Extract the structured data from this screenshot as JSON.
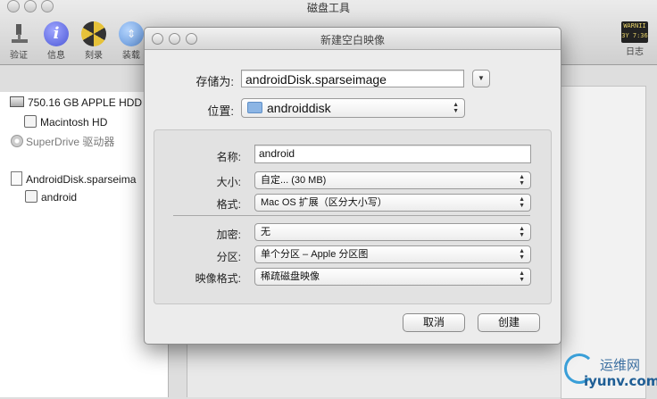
{
  "app": {
    "title": "磁盘工具",
    "toolbar": [
      {
        "label": "验证",
        "icon": "microscope-icon"
      },
      {
        "label": "信息",
        "icon": "info-icon"
      },
      {
        "label": "刻录",
        "icon": "burn-icon"
      },
      {
        "label": "装载",
        "icon": "mount-icon"
      },
      {
        "label": "日志",
        "icon": "log-icon",
        "icon_text": "WARNII\n3Y 7:36"
      }
    ],
    "sidebar": {
      "items": [
        {
          "label": "750.16 GB APPLE HDD",
          "type": "disk"
        },
        {
          "label": "Macintosh HD",
          "type": "volume"
        },
        {
          "label": "SuperDrive 驱动器",
          "type": "optical"
        },
        {
          "label": "AndroidDisk.sparseima",
          "type": "image"
        },
        {
          "label": "android",
          "type": "volume"
        }
      ]
    }
  },
  "dialog": {
    "title": "新建空白映像",
    "save_as": {
      "label": "存储为:",
      "value": "androidDisk.sparseimage"
    },
    "where": {
      "label": "位置:",
      "value": "androiddisk"
    },
    "name": {
      "label": "名称:",
      "value": "android"
    },
    "size": {
      "label": "大小:",
      "value": "自定... (30 MB)"
    },
    "format": {
      "label": "格式:",
      "value": "Mac OS 扩展（区分大小写）"
    },
    "encryption": {
      "label": "加密:",
      "value": "无"
    },
    "partitions": {
      "label": "分区:",
      "value": "单个分区 – Apple 分区图"
    },
    "image_format": {
      "label": "映像格式:",
      "value": "稀疏磁盘映像"
    },
    "buttons": {
      "cancel": "取消",
      "create": "创建"
    }
  },
  "watermark": {
    "line1": "运维网",
    "line2": "iyunv.com"
  },
  "colors": {
    "folder": "#8cb5e4",
    "watermark": "#3a9fd8"
  }
}
